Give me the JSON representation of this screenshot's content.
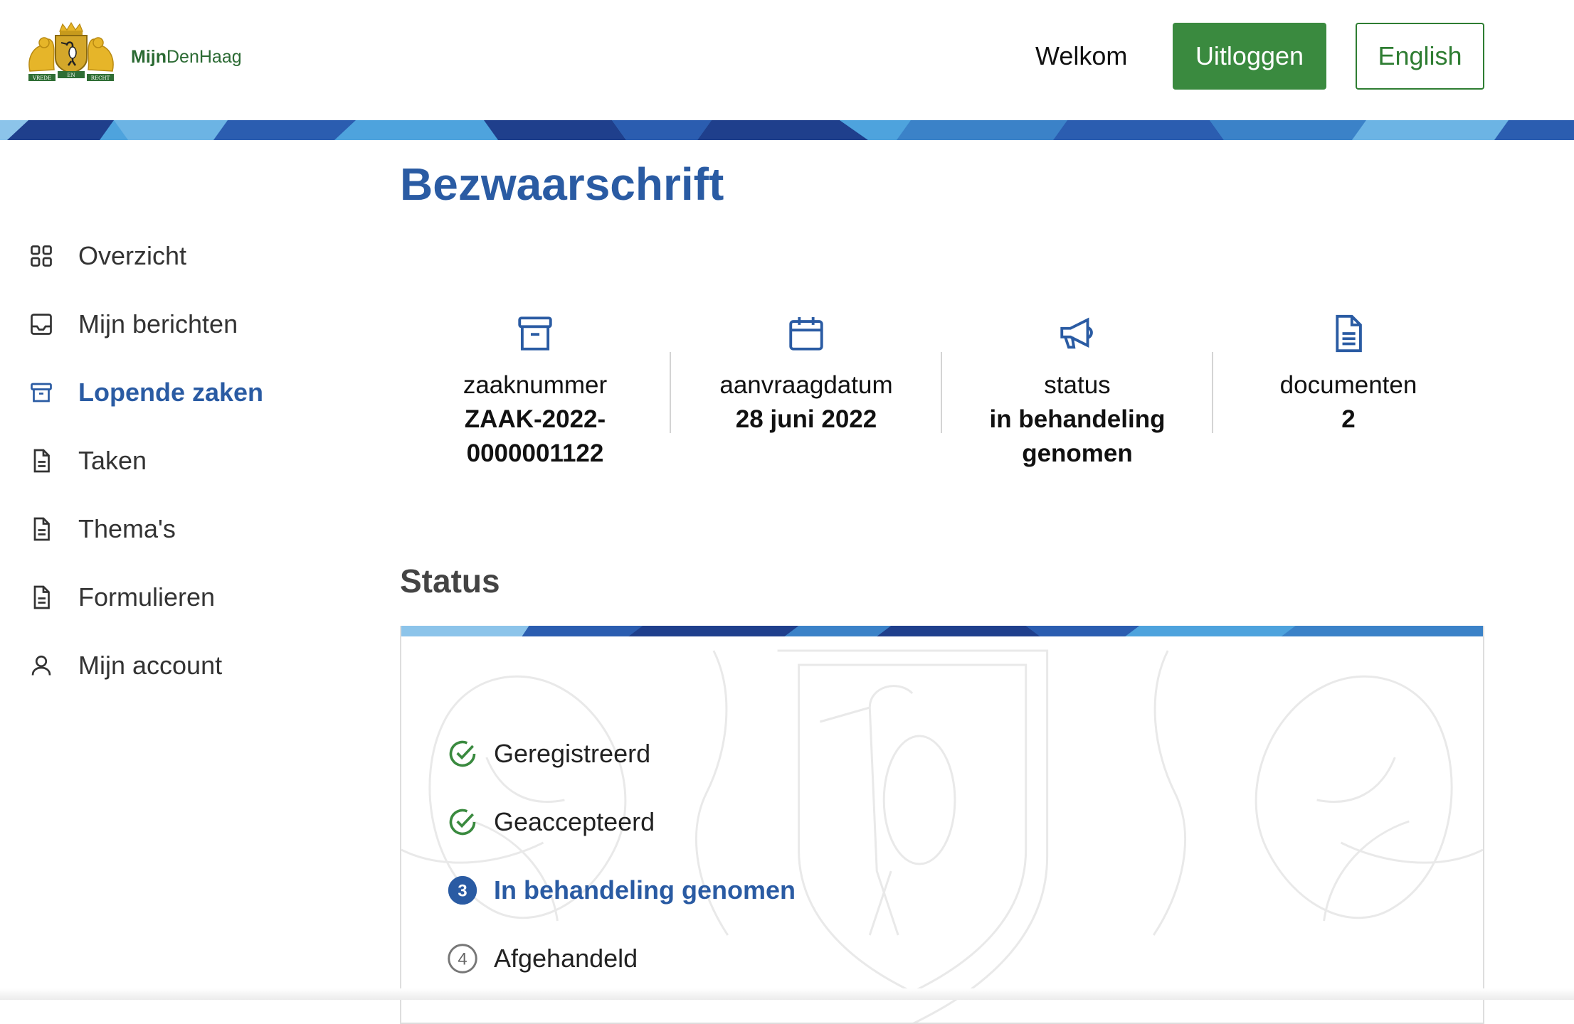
{
  "header": {
    "logo_motto": [
      "VREDE",
      "EN",
      "RECHT"
    ],
    "logo_text_bold": "Mijn",
    "logo_text_regular": "DenHaag",
    "welcome": "Welkom",
    "logout_label": "Uitloggen",
    "language_label": "English"
  },
  "colors": {
    "primary_blue": "#2a5ba3",
    "green": "#3a8a3f",
    "banner_dark": "#1f3f8c",
    "banner_light": "#4ea3dd"
  },
  "sidebar": {
    "items": [
      {
        "label": "Overzicht",
        "icon": "grid-icon",
        "active": false
      },
      {
        "label": "Mijn berichten",
        "icon": "inbox-icon",
        "active": false
      },
      {
        "label": "Lopende zaken",
        "icon": "archive-icon",
        "active": true
      },
      {
        "label": "Taken",
        "icon": "document-icon",
        "active": false
      },
      {
        "label": "Thema's",
        "icon": "document-icon",
        "active": false
      },
      {
        "label": "Formulieren",
        "icon": "document-icon",
        "active": false
      },
      {
        "label": "Mijn account",
        "icon": "user-icon",
        "active": false
      }
    ]
  },
  "main": {
    "title": "Bezwaarschrift",
    "meta": [
      {
        "icon": "archive-icon",
        "label": "zaaknummer",
        "value_lines": [
          "ZAAK-2022-",
          "0000001122"
        ]
      },
      {
        "icon": "calendar-icon",
        "label": "aanvraagdatum",
        "value_lines": [
          "28 juni 2022"
        ]
      },
      {
        "icon": "megaphone-icon",
        "label": "status",
        "value_lines": [
          "in behandeling",
          "genomen"
        ]
      },
      {
        "icon": "document-icon",
        "label": "documenten",
        "value_lines": [
          "2"
        ]
      }
    ],
    "status_title": "Status",
    "steps": [
      {
        "label": "Geregistreerd",
        "state": "done"
      },
      {
        "label": "Geaccepteerd",
        "state": "done"
      },
      {
        "label": "In behandeling genomen",
        "state": "current",
        "number": "3"
      },
      {
        "label": "Afgehandeld",
        "state": "todo",
        "number": "4"
      }
    ]
  }
}
